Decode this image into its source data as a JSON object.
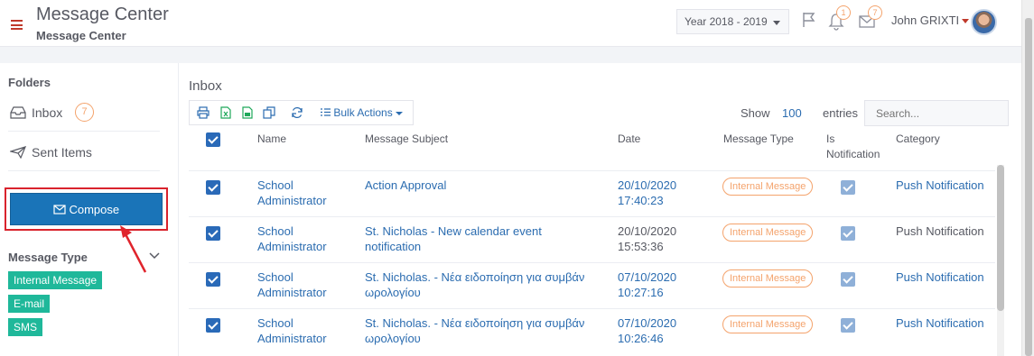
{
  "header": {
    "title": "Message Center",
    "subtitle": "Message Center",
    "year_select": "Year 2018 - 2019",
    "notification_count": "1",
    "message_count": "7",
    "user_name": "John GRIXTI"
  },
  "sidebar": {
    "folders_label": "Folders",
    "folders": [
      {
        "label": "Inbox",
        "badge": "7"
      },
      {
        "label": "Sent Items"
      }
    ],
    "compose_label": "Compose",
    "message_type_label": "Message Type",
    "message_types": [
      "Internal Message",
      "E-mail",
      "SMS"
    ]
  },
  "main": {
    "inbox_label": "Inbox",
    "bulk_actions_label": "Bulk Actions",
    "show_label": "Show",
    "show_value": "100",
    "entries_label": "entries",
    "search_placeholder": "Search...",
    "columns": [
      "Name",
      "Message Subject",
      "Date",
      "Message Type",
      "Is",
      "Notification",
      "Category"
    ],
    "rows": [
      {
        "name1": "School",
        "name2": "Administrator",
        "subject1": "Action Approval",
        "subject2": "",
        "date1": "20/10/2020",
        "date2": "17:40:23",
        "type": "Internal Message",
        "category": "Push Notification",
        "category_link": true
      },
      {
        "name1": "School",
        "name2": "Administrator",
        "subject1": "St. Nicholas - New calendar event",
        "subject2": "notification",
        "date1": "20/10/2020",
        "date2": "15:53:36",
        "type": "Internal Message",
        "category": "Push Notification",
        "category_link": false
      },
      {
        "name1": "School",
        "name2": "Administrator",
        "subject1": "St. Nicholas. - Νέα ειδοποίηση για συμβάν",
        "subject2": "ωρολογίου",
        "date1": "07/10/2020",
        "date2": "10:27:16",
        "type": "Internal Message",
        "category": "Push Notification",
        "category_link": true
      },
      {
        "name1": "School",
        "name2": "Administrator",
        "subject1": "St. Nicholas. - Νέα ειδοποίηση για συμβάν",
        "subject2": "ωρολογίου",
        "date1": "07/10/2020",
        "date2": "10:26:46",
        "type": "Internal Message",
        "category": "Push Notification",
        "category_link": true
      }
    ]
  },
  "colors": {
    "accent_blue": "#1a74b8",
    "link_blue": "#2b6cb0",
    "badge_orange": "#f4a36c",
    "tag_green": "#1fb89a",
    "highlight_red": "#d9232d"
  }
}
